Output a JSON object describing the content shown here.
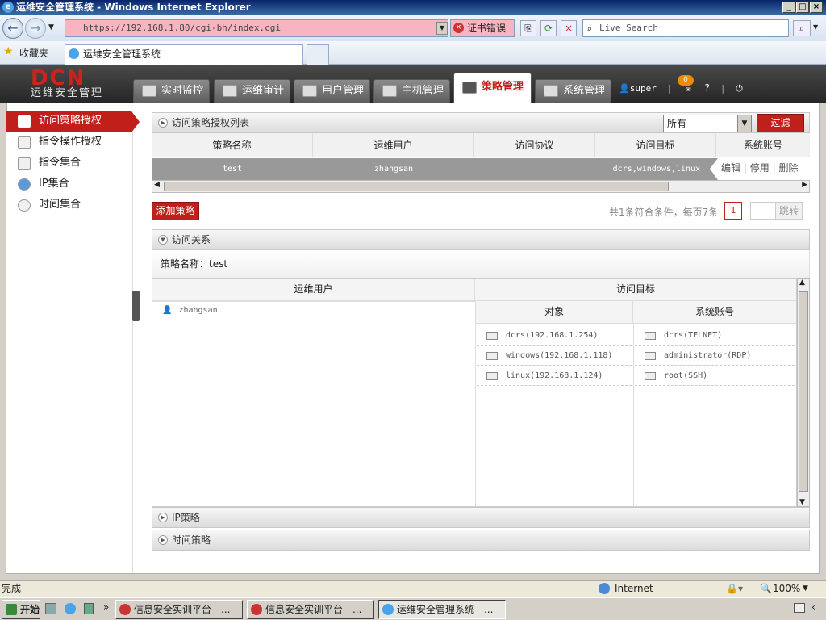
{
  "window": {
    "title": "运维安全管理系统 - Windows Internet Explorer"
  },
  "browser": {
    "url": "https://192.168.1.80/cgi-bh/index.cgi",
    "cert_error": "证书错误",
    "search_placeholder": "Live Search",
    "favorites_label": "收藏夹",
    "tab_title": "运维安全管理系统"
  },
  "app": {
    "logo": "DCN",
    "subtitle": "运维安全管理",
    "tabs": [
      {
        "label": "实时监控"
      },
      {
        "label": "运维审计"
      },
      {
        "label": "用户管理"
      },
      {
        "label": "主机管理"
      },
      {
        "label": "策略管理"
      },
      {
        "label": "系统管理"
      }
    ],
    "user": "super",
    "message_count": "0",
    "help": "?",
    "logout": "⏻"
  },
  "sidebar": {
    "items": [
      {
        "label": "访问策略授权"
      },
      {
        "label": "指令操作授权"
      },
      {
        "label": "指令集合"
      },
      {
        "label": "IP集合"
      },
      {
        "label": "时间集合"
      }
    ]
  },
  "list_panel": {
    "title": "访问策略授权列表",
    "filter_value": "所有",
    "filter_button": "过滤",
    "columns": [
      "策略名称",
      "运维用户",
      "访问协议",
      "访问目标",
      "系统账号"
    ],
    "rows": [
      {
        "name": "test",
        "user": "zhangsan",
        "protocol": "",
        "target": "dcrs,windows,linux",
        "account": ""
      }
    ],
    "actions": {
      "edit": "编辑",
      "disable": "停用",
      "delete": "删除",
      "sep": "|"
    },
    "add_button": "添加策略",
    "pagination_info": "共1条符合条件，每页7条",
    "current_page": "1",
    "jump_button": "跳转"
  },
  "relation_panel": {
    "title": "访问关系",
    "policy_label": "策略名称：test",
    "col_user": "运维用户",
    "col_target": "访问目标",
    "sub_object": "对象",
    "sub_account": "系统账号",
    "user": "zhangsan",
    "objects": [
      "dcrs(192.168.1.254)",
      "windows(192.168.1.118)",
      "linux(192.168.1.124)"
    ],
    "accounts": [
      "dcrs(TELNET)",
      "administrator(RDP)",
      "root(SSH)"
    ]
  },
  "ip_panel": {
    "title": "IP策略"
  },
  "time_panel": {
    "title": "时间策略"
  },
  "status": {
    "text": "完成",
    "zone": "Internet",
    "zoom": "100%"
  },
  "taskbar": {
    "start": "开始",
    "tasks": [
      {
        "label": "信息安全实训平台 - ..."
      },
      {
        "label": "信息安全实训平台 - ..."
      },
      {
        "label": "运维安全管理系统 - ..."
      }
    ]
  }
}
